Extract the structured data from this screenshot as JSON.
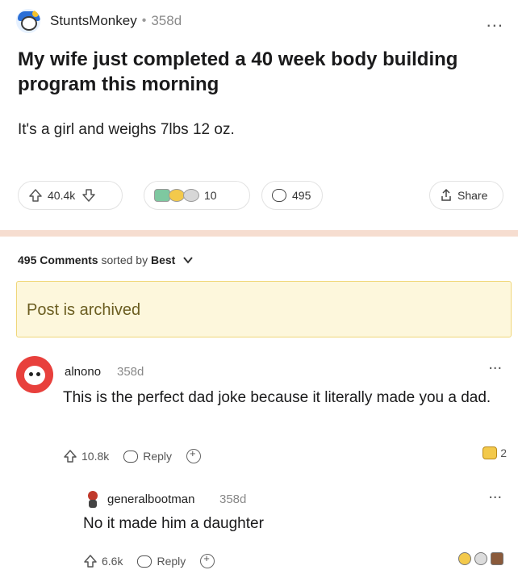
{
  "post": {
    "username": "StuntsMonkey",
    "separator": "•",
    "age": "358d",
    "more": "...",
    "title": "My wife just completed a 40 week body building program this morning",
    "body": "It's a girl and weighs 7lbs 12 oz.",
    "votes": "40.4k",
    "award_count": "10",
    "comment_count": "495",
    "share_label": "Share"
  },
  "comments_header": {
    "count_label": "495 Comments",
    "sorted_by": "sorted by",
    "sort_value": "Best"
  },
  "archived_notice": "Post is archived",
  "comments": [
    {
      "username": "alnono",
      "age": "358d",
      "more": "...",
      "text": "This is the perfect dad joke because it literally made you a dad.",
      "votes": "10.8k",
      "reply_label": "Reply",
      "award_count": "2"
    },
    {
      "username": "generalbootman",
      "age": "358d",
      "more": "...",
      "text": "No it made him a daughter",
      "votes": "6.6k",
      "reply_label": "Reply"
    }
  ],
  "colors": {
    "divider": "#f6ddd0",
    "archived_bg": "#fdf7dc",
    "archived_border": "#f0d77a",
    "avatar_red": "#e8403c"
  }
}
